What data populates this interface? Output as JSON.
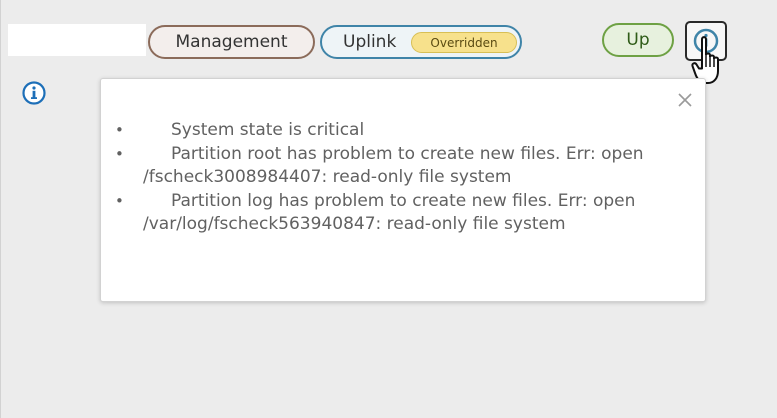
{
  "row": {
    "pills": {
      "management": {
        "label": "Management",
        "border_color": "#8b6b5a"
      },
      "uplink": {
        "label": "Uplink",
        "badge": "Overridden",
        "border_color": "#3f84a8",
        "badge_color": "#f7e18c"
      },
      "status": {
        "label": "Up",
        "border_color": "#6ea144"
      }
    },
    "status_button": {
      "icon": "info-circle-icon"
    },
    "cursor": {
      "icon": "hand-pointer-icon"
    },
    "info_icon": {
      "icon": "info-circle-icon",
      "color": "#1d6fb8"
    }
  },
  "popover": {
    "close_icon": "close-icon",
    "messages": [
      "System state is critical",
      "Partition root has problem to create new files. Err: open /fscheck3008984407: read-only file system",
      "Partition log has problem to create new files. Err: open /var/log/fscheck563940847: read-only file system"
    ]
  }
}
